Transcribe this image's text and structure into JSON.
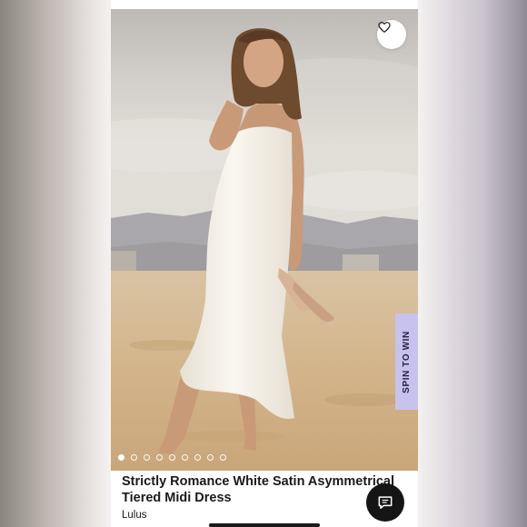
{
  "product": {
    "title": "Strictly Romance White Satin Asymmetrical Tiered Midi Dress",
    "brand": "Lulus",
    "photo_alt": "Model wearing white satin midi dress on a beach"
  },
  "gallery": {
    "image_count": 9,
    "active_index": 0
  },
  "spin_tab": {
    "label": "SPIN TO WIN"
  },
  "icons": {
    "favorite": "heart-outline-icon",
    "chat": "chat-bubble-icon"
  },
  "colors": {
    "spin_tab_bg": "#c8c2ee",
    "chat_button_bg": "#151515",
    "sand": "#d8b990",
    "dress": "#f4f0e8"
  }
}
